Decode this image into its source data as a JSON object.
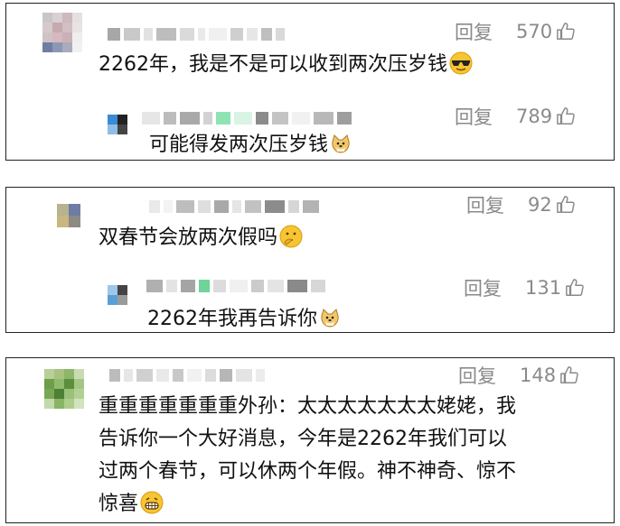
{
  "comments": [
    {
      "reply_label": "回复",
      "likes": "570",
      "text": "2262年，我是不是可以收到两次压岁钱",
      "emoji": "sunglasses-face",
      "reply": {
        "reply_label": "回复",
        "likes": "789",
        "text": "可能得发两次压岁钱",
        "emoji": "doge-face"
      }
    },
    {
      "reply_label": "回复",
      "likes": "92",
      "text": "双春节会放两次假吗",
      "emoji": "thinking-face",
      "reply": {
        "reply_label": "回复",
        "likes": "131",
        "text": "2262年我再告诉你",
        "emoji": "doge-face"
      }
    },
    {
      "reply_label": "回复",
      "likes": "148",
      "text_lines": [
        "重重重重重重重外孙：太太太太太太太姥姥，我",
        "告诉你一个大好消息，今年是2262年我们可以",
        "过两个春节，可以休两个年假。神不神奇、惊不",
        "惊喜"
      ],
      "emoji": "grinning-face"
    }
  ],
  "colors": {
    "meta": "#8a8a8a",
    "border": "#222222"
  }
}
